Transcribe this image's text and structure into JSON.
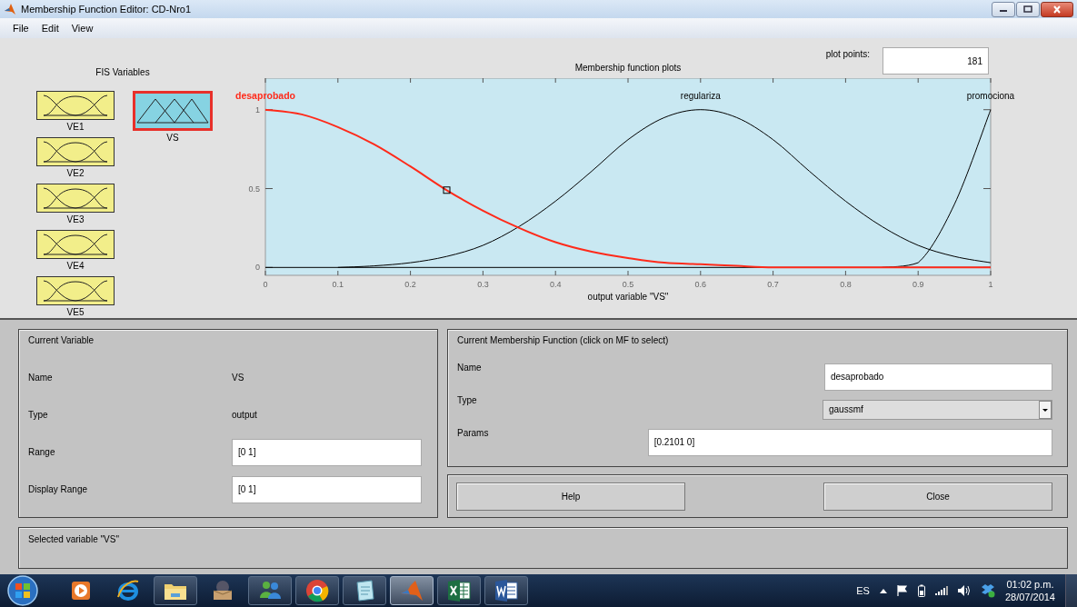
{
  "window": {
    "title": "Membership Function Editor: CD-Nro1"
  },
  "menu": [
    "File",
    "Edit",
    "View"
  ],
  "fis_variables": {
    "title": "FIS Variables",
    "items": [
      {
        "name": "VE1",
        "kind": "input",
        "selected": false
      },
      {
        "name": "VE2",
        "kind": "input",
        "selected": false
      },
      {
        "name": "VE3",
        "kind": "input",
        "selected": false
      },
      {
        "name": "VE4",
        "kind": "input",
        "selected": false
      },
      {
        "name": "VE5",
        "kind": "input",
        "selected": false
      },
      {
        "name": "VS",
        "kind": "output",
        "selected": true
      }
    ]
  },
  "plot": {
    "plot_points": {
      "label": "plot points:",
      "value": "181"
    },
    "chart_data": {
      "type": "line",
      "title": "Membership function plots",
      "xlabel": "output variable \"VS\"",
      "x": [
        0,
        0.05,
        0.1,
        0.15,
        0.2,
        0.25,
        0.3,
        0.35,
        0.4,
        0.45,
        0.5,
        0.55,
        0.6,
        0.65,
        0.7,
        0.75,
        0.8,
        0.85,
        0.9,
        0.95,
        1
      ],
      "series": [
        {
          "name": "desaprobado",
          "color": "#ff2a1a",
          "values": [
            1,
            0.97,
            0.89,
            0.78,
            0.64,
            0.49,
            0.36,
            0.25,
            0.16,
            0.1,
            0.06,
            0.03,
            0.02,
            0.01,
            0,
            0,
            0,
            0,
            0,
            0,
            0
          ]
        },
        {
          "name": "regulariza",
          "color": "#000000",
          "values": [
            null,
            null,
            0,
            0.01,
            0.03,
            0.07,
            0.14,
            0.26,
            0.42,
            0.61,
            0.81,
            0.95,
            1,
            0.95,
            0.81,
            0.61,
            0.42,
            0.26,
            0.14,
            0.07,
            0.03
          ]
        },
        {
          "name": "promociona",
          "color": "#000000",
          "values": [
            null,
            null,
            null,
            null,
            null,
            null,
            null,
            null,
            null,
            null,
            null,
            null,
            null,
            null,
            null,
            null,
            null,
            0,
            0.03,
            0.4,
            1
          ]
        }
      ],
      "xlim": [
        0,
        1
      ],
      "ylim": [
        -0.05,
        1.2
      ],
      "xticks": [
        0,
        0.1,
        0.2,
        0.3,
        0.4,
        0.5,
        0.6,
        0.7,
        0.8,
        0.9,
        1
      ],
      "yticks": [
        0,
        0.5,
        1
      ]
    }
  },
  "current_variable": {
    "title": "Current Variable",
    "fields": [
      {
        "label": "Name",
        "value": "VS",
        "kind": "text"
      },
      {
        "label": "Type",
        "value": "output",
        "kind": "text"
      },
      {
        "label": "Range",
        "value": "[0 1]",
        "kind": "input"
      },
      {
        "label": "Display Range",
        "value": "[0 1]",
        "kind": "input"
      }
    ]
  },
  "current_mf": {
    "title": "Current Membership Function (click on MF to select)",
    "fields": [
      {
        "label": "Name",
        "value": "desaprobado",
        "kind": "input"
      },
      {
        "label": "Type",
        "value": "gaussmf",
        "kind": "dropdown"
      },
      {
        "label": "Params",
        "value": "[0.2101 0]",
        "kind": "wide-input"
      }
    ]
  },
  "buttons": [
    "Help",
    "Close"
  ],
  "status": "Selected variable \"VS\"",
  "taskbar": {
    "apps": [
      {
        "kind": "media",
        "running": false,
        "active": false
      },
      {
        "kind": "browser",
        "running": false,
        "active": false
      },
      {
        "kind": "folder",
        "running": true,
        "active": false
      },
      {
        "kind": "box",
        "running": false,
        "active": false
      },
      {
        "kind": "messenger",
        "running": true,
        "active": false
      },
      {
        "kind": "chrome",
        "running": true,
        "active": false
      },
      {
        "kind": "notepad",
        "running": true,
        "active": false
      },
      {
        "kind": "matlab",
        "running": true,
        "active": true
      },
      {
        "kind": "excel",
        "running": true,
        "active": false
      },
      {
        "kind": "word",
        "running": true,
        "active": false
      }
    ],
    "language": "ES",
    "time": "01:02 p.m.",
    "date": "28/07/2014"
  }
}
